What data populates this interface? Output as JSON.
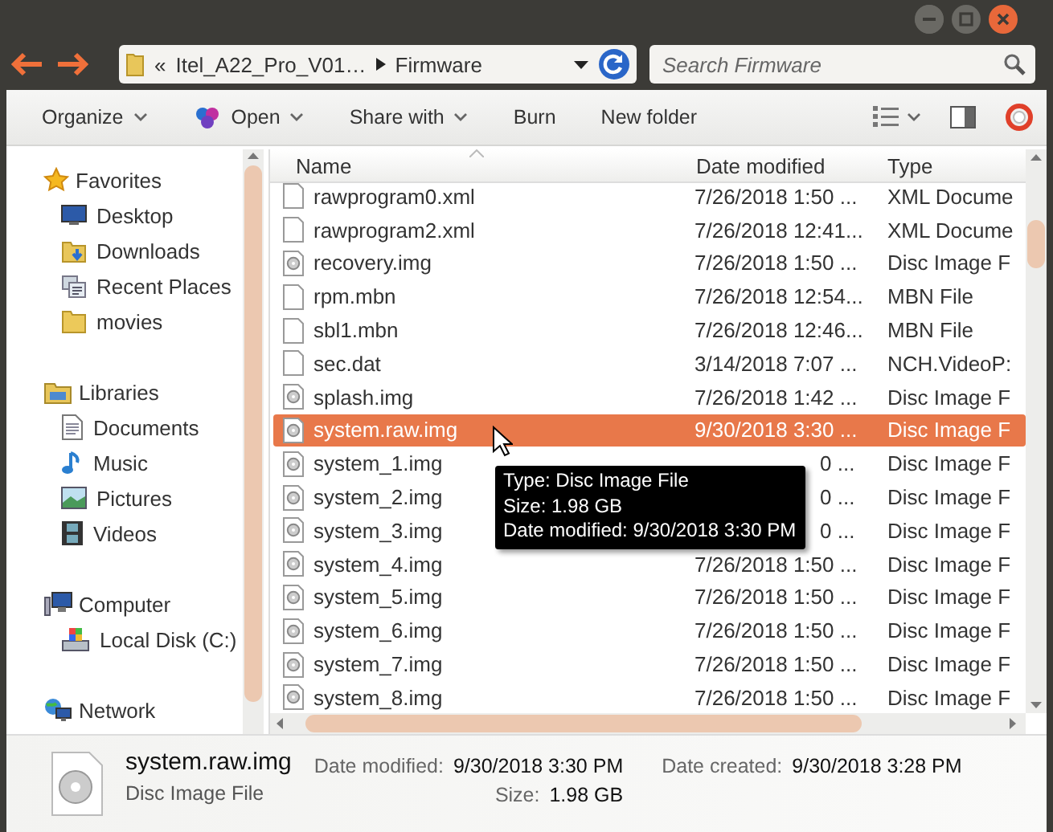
{
  "address": {
    "overflow": "«",
    "crumbs": [
      "Itel_A22_Pro_V01…",
      "Firmware"
    ]
  },
  "search": {
    "placeholder": "Search Firmware"
  },
  "toolbar": [
    {
      "label": "Organize",
      "kind": "menu"
    },
    {
      "label": "Open",
      "kind": "open"
    },
    {
      "label": "Share with",
      "kind": "menu"
    },
    {
      "label": "Burn",
      "kind": "plain"
    },
    {
      "label": "New folder",
      "kind": "plain"
    }
  ],
  "sidebar": [
    {
      "label": "Favorites",
      "kind": "star",
      "children": [
        {
          "label": "Desktop",
          "kind": "desktop"
        },
        {
          "label": "Downloads",
          "kind": "downloads"
        },
        {
          "label": "Recent Places",
          "kind": "recent"
        },
        {
          "label": "movies",
          "kind": "folder"
        }
      ]
    },
    {
      "label": "Libraries",
      "kind": "library",
      "children": [
        {
          "label": "Documents",
          "kind": "document"
        },
        {
          "label": "Music",
          "kind": "music"
        },
        {
          "label": "Pictures",
          "kind": "pictures"
        },
        {
          "label": "Videos",
          "kind": "videos"
        }
      ]
    },
    {
      "label": "Computer",
      "kind": "computer",
      "children": [
        {
          "label": "Local Disk (C:)",
          "kind": "disk"
        }
      ]
    },
    {
      "label": "Network",
      "kind": "network"
    }
  ],
  "columns": [
    "Name",
    "Date modified",
    "Type"
  ],
  "files": [
    {
      "name": "rawprogram0.xml",
      "date": "7/26/2018 1:50 ...",
      "type": "XML Docume",
      "kind": "plain",
      "selected": false
    },
    {
      "name": "rawprogram2.xml",
      "date": "7/26/2018 12:41...",
      "type": "XML Docume",
      "kind": "plain",
      "selected": false
    },
    {
      "name": "recovery.img",
      "date": "7/26/2018 1:50 ...",
      "type": "Disc Image F",
      "kind": "disc",
      "selected": false
    },
    {
      "name": "rpm.mbn",
      "date": "7/26/2018 12:54...",
      "type": "MBN File",
      "kind": "plain",
      "selected": false
    },
    {
      "name": "sbl1.mbn",
      "date": "7/26/2018 12:46...",
      "type": "MBN File",
      "kind": "plain",
      "selected": false
    },
    {
      "name": "sec.dat",
      "date": "3/14/2018 7:07 ...",
      "type": "NCH.VideoP:",
      "kind": "plain",
      "selected": false
    },
    {
      "name": "splash.img",
      "date": "7/26/2018 1:42 ...",
      "type": "Disc Image F",
      "kind": "disc",
      "selected": false
    },
    {
      "name": "system.raw.img",
      "date": "9/30/2018 3:30 ...",
      "type": "Disc Image F",
      "kind": "disc",
      "selected": true
    },
    {
      "name": "system_1.img",
      "date": "0 ...",
      "type": "Disc Image F",
      "kind": "disc",
      "selected": false,
      "covered": true
    },
    {
      "name": "system_2.img",
      "date": "0 ...",
      "type": "Disc Image F",
      "kind": "disc",
      "selected": false,
      "covered": true
    },
    {
      "name": "system_3.img",
      "date": "0 ...",
      "type": "Disc Image F",
      "kind": "disc",
      "selected": false,
      "covered": true
    },
    {
      "name": "system_4.img",
      "date": "7/26/2018 1:50 ...",
      "type": "Disc Image F",
      "kind": "disc",
      "selected": false
    },
    {
      "name": "system_5.img",
      "date": "7/26/2018 1:50 ...",
      "type": "Disc Image F",
      "kind": "disc",
      "selected": false
    },
    {
      "name": "system_6.img",
      "date": "7/26/2018 1:50 ...",
      "type": "Disc Image F",
      "kind": "disc",
      "selected": false
    },
    {
      "name": "system_7.img",
      "date": "7/26/2018 1:50 ...",
      "type": "Disc Image F",
      "kind": "disc",
      "selected": false
    },
    {
      "name": "system_8.img",
      "date": "7/26/2018 1:50 ...",
      "type": "Disc Image F",
      "kind": "disc",
      "selected": false
    }
  ],
  "tooltip": [
    "Type: Disc Image File",
    "Size: 1.98 GB",
    "Date modified: 9/30/2018 3:30 PM"
  ],
  "details": {
    "name": "system.raw.img",
    "type": "Disc Image File",
    "fields": [
      {
        "label": "Date modified:",
        "value": "9/30/2018 3:30 PM"
      },
      {
        "label": "Size:",
        "value": "1.98 GB"
      },
      {
        "label": "Date created:",
        "value": "9/30/2018 3:28 PM"
      }
    ]
  }
}
